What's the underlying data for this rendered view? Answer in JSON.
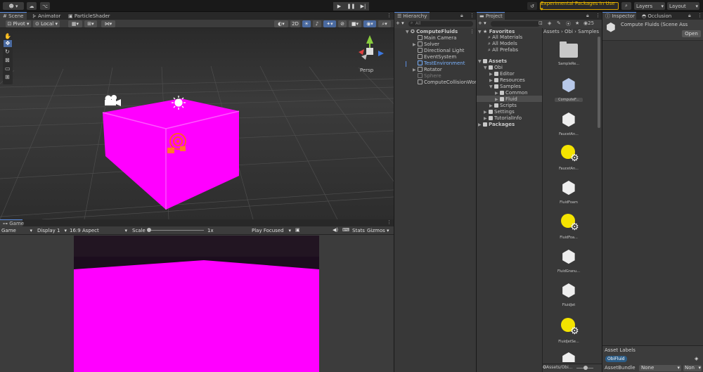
{
  "topbar": {
    "account_label": "",
    "experimental_label": "Experimental Packages In Use ▾",
    "layers_label": "Layers",
    "layout_label": "Layout"
  },
  "scene": {
    "tabs": [
      {
        "label": "Scene"
      },
      {
        "label": "Animator"
      },
      {
        "label": "ParticleShader"
      }
    ],
    "toolbar": {
      "pivot": "Pivot",
      "local": "Local",
      "mode_2d": "2D"
    },
    "persp_label": "Persp"
  },
  "game": {
    "tab": "Game",
    "display_select": "Game",
    "display": "Display 1",
    "aspect": "16:9 Aspect",
    "scale_label": "Scale",
    "scale_value": "1x",
    "play_focused": "Play Focused",
    "stats": "Stats",
    "gizmos": "Gizmos"
  },
  "hierarchy": {
    "tab": "Hierarchy",
    "search_placeholder": "All",
    "root": "ComputeFluids",
    "items": [
      {
        "label": "Main Camera"
      },
      {
        "label": "Solver"
      },
      {
        "label": "Directional Light"
      },
      {
        "label": "EventSystem"
      },
      {
        "label": "TestEnvironment"
      },
      {
        "label": "Rotator"
      },
      {
        "label": "Sphere"
      },
      {
        "label": "ComputeCollisionWorld"
      }
    ]
  },
  "project": {
    "tab": "Project",
    "visible_count": "25",
    "breadcrumb": "Assets › Obi › Samples",
    "favorites_label": "Favorites",
    "favorites": [
      {
        "label": "All Materials"
      },
      {
        "label": "All Models"
      },
      {
        "label": "All Prefabs"
      }
    ],
    "tree": [
      {
        "label": "Assets"
      },
      {
        "label": "Obi"
      },
      {
        "label": "Editor"
      },
      {
        "label": "Resources"
      },
      {
        "label": "Samples"
      },
      {
        "label": "Common"
      },
      {
        "label": "Fluid"
      },
      {
        "label": "Scripts"
      },
      {
        "label": "Settings"
      },
      {
        "label": "TutorialInfo"
      },
      {
        "label": "Packages"
      }
    ],
    "assets": [
      {
        "label": "SampleRe..."
      },
      {
        "label": "ComputeF..."
      },
      {
        "label": "FaucetAn..."
      },
      {
        "label": "FaucetAn..."
      },
      {
        "label": "FluidFoam"
      },
      {
        "label": "FluidFoa..."
      },
      {
        "label": "FluidGranu..."
      },
      {
        "label": "FluidJet"
      },
      {
        "label": "FluidJetSe..."
      }
    ],
    "footer_path": "Assets/Obi..."
  },
  "inspector": {
    "tabs": [
      {
        "label": "Inspector"
      },
      {
        "label": "Occlusion"
      }
    ],
    "title": "Compute Fluids (Scene Ass",
    "open_button": "Open",
    "asset_labels_title": "Asset Labels",
    "asset_label_tag": "ObiFluid",
    "asset_bundle_label": "AssetBundle",
    "asset_bundle_value": "None",
    "asset_variant_value": "Non"
  },
  "colors": {
    "accent": "#5b8de0",
    "fluid_magenta": "#ff00ff",
    "selected_row": "#2c5d87",
    "warning_border": "#d9a400"
  }
}
